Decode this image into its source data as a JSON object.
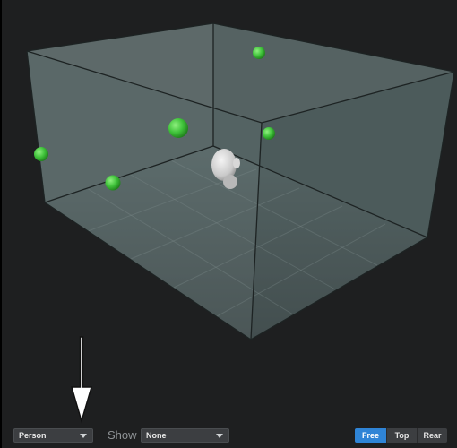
{
  "toolbar": {
    "view_select": {
      "value": "Person",
      "icon": "chevron-down-icon"
    },
    "show_label": "Show",
    "show_select": {
      "value": "None",
      "icon": "chevron-down-icon"
    },
    "camera_modes": [
      {
        "label": "Free",
        "active": true
      },
      {
        "label": "Top",
        "active": false
      },
      {
        "label": "Rear",
        "active": false
      }
    ]
  },
  "scene": {
    "listener_icon": "head-icon",
    "source_icon": "sphere-icon",
    "source_color": "#3fc23a",
    "accent_color": "#2f84d6"
  },
  "annotation": {
    "icon": "down-arrow-icon"
  }
}
